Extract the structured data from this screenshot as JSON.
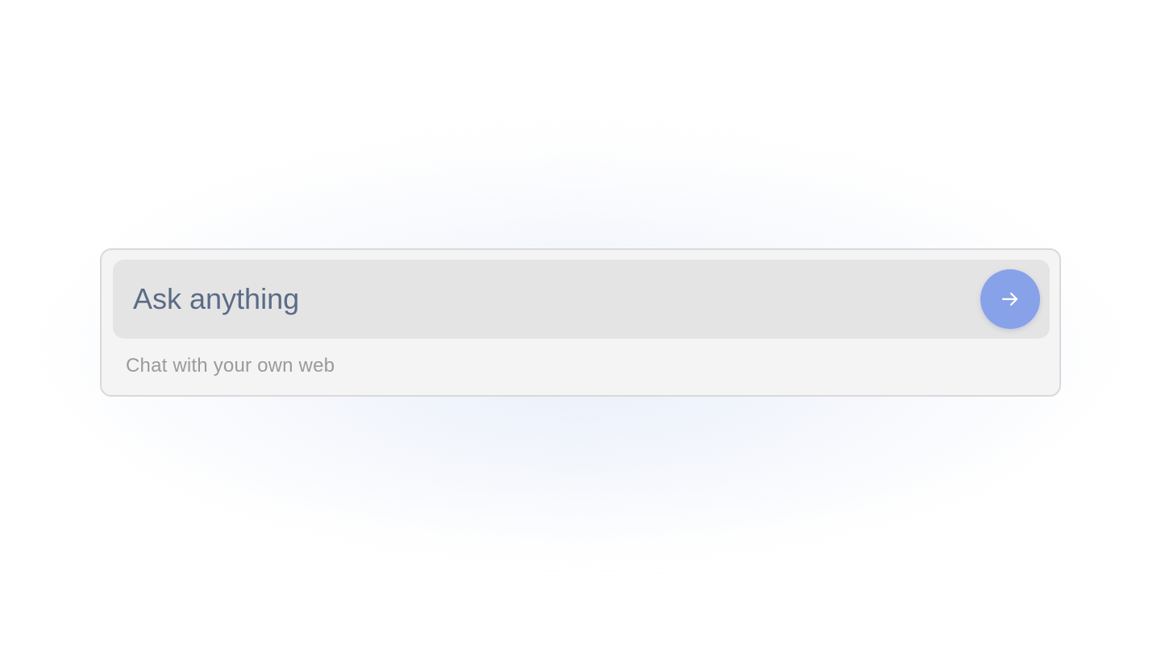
{
  "composer": {
    "input": {
      "placeholder": "Ask anything",
      "value": ""
    },
    "send_button": {
      "icon": "arrow-right-icon",
      "label": "Send",
      "color": "#87a2e8"
    },
    "caption": "Chat with your own web"
  },
  "colors": {
    "background": "#ffffff",
    "composer_background": "#f4f4f4",
    "input_background": "#e4e4e4",
    "accent": "#87a2e8",
    "placeholder_text": "#5a6b86",
    "caption_text": "#9a9a9a"
  }
}
